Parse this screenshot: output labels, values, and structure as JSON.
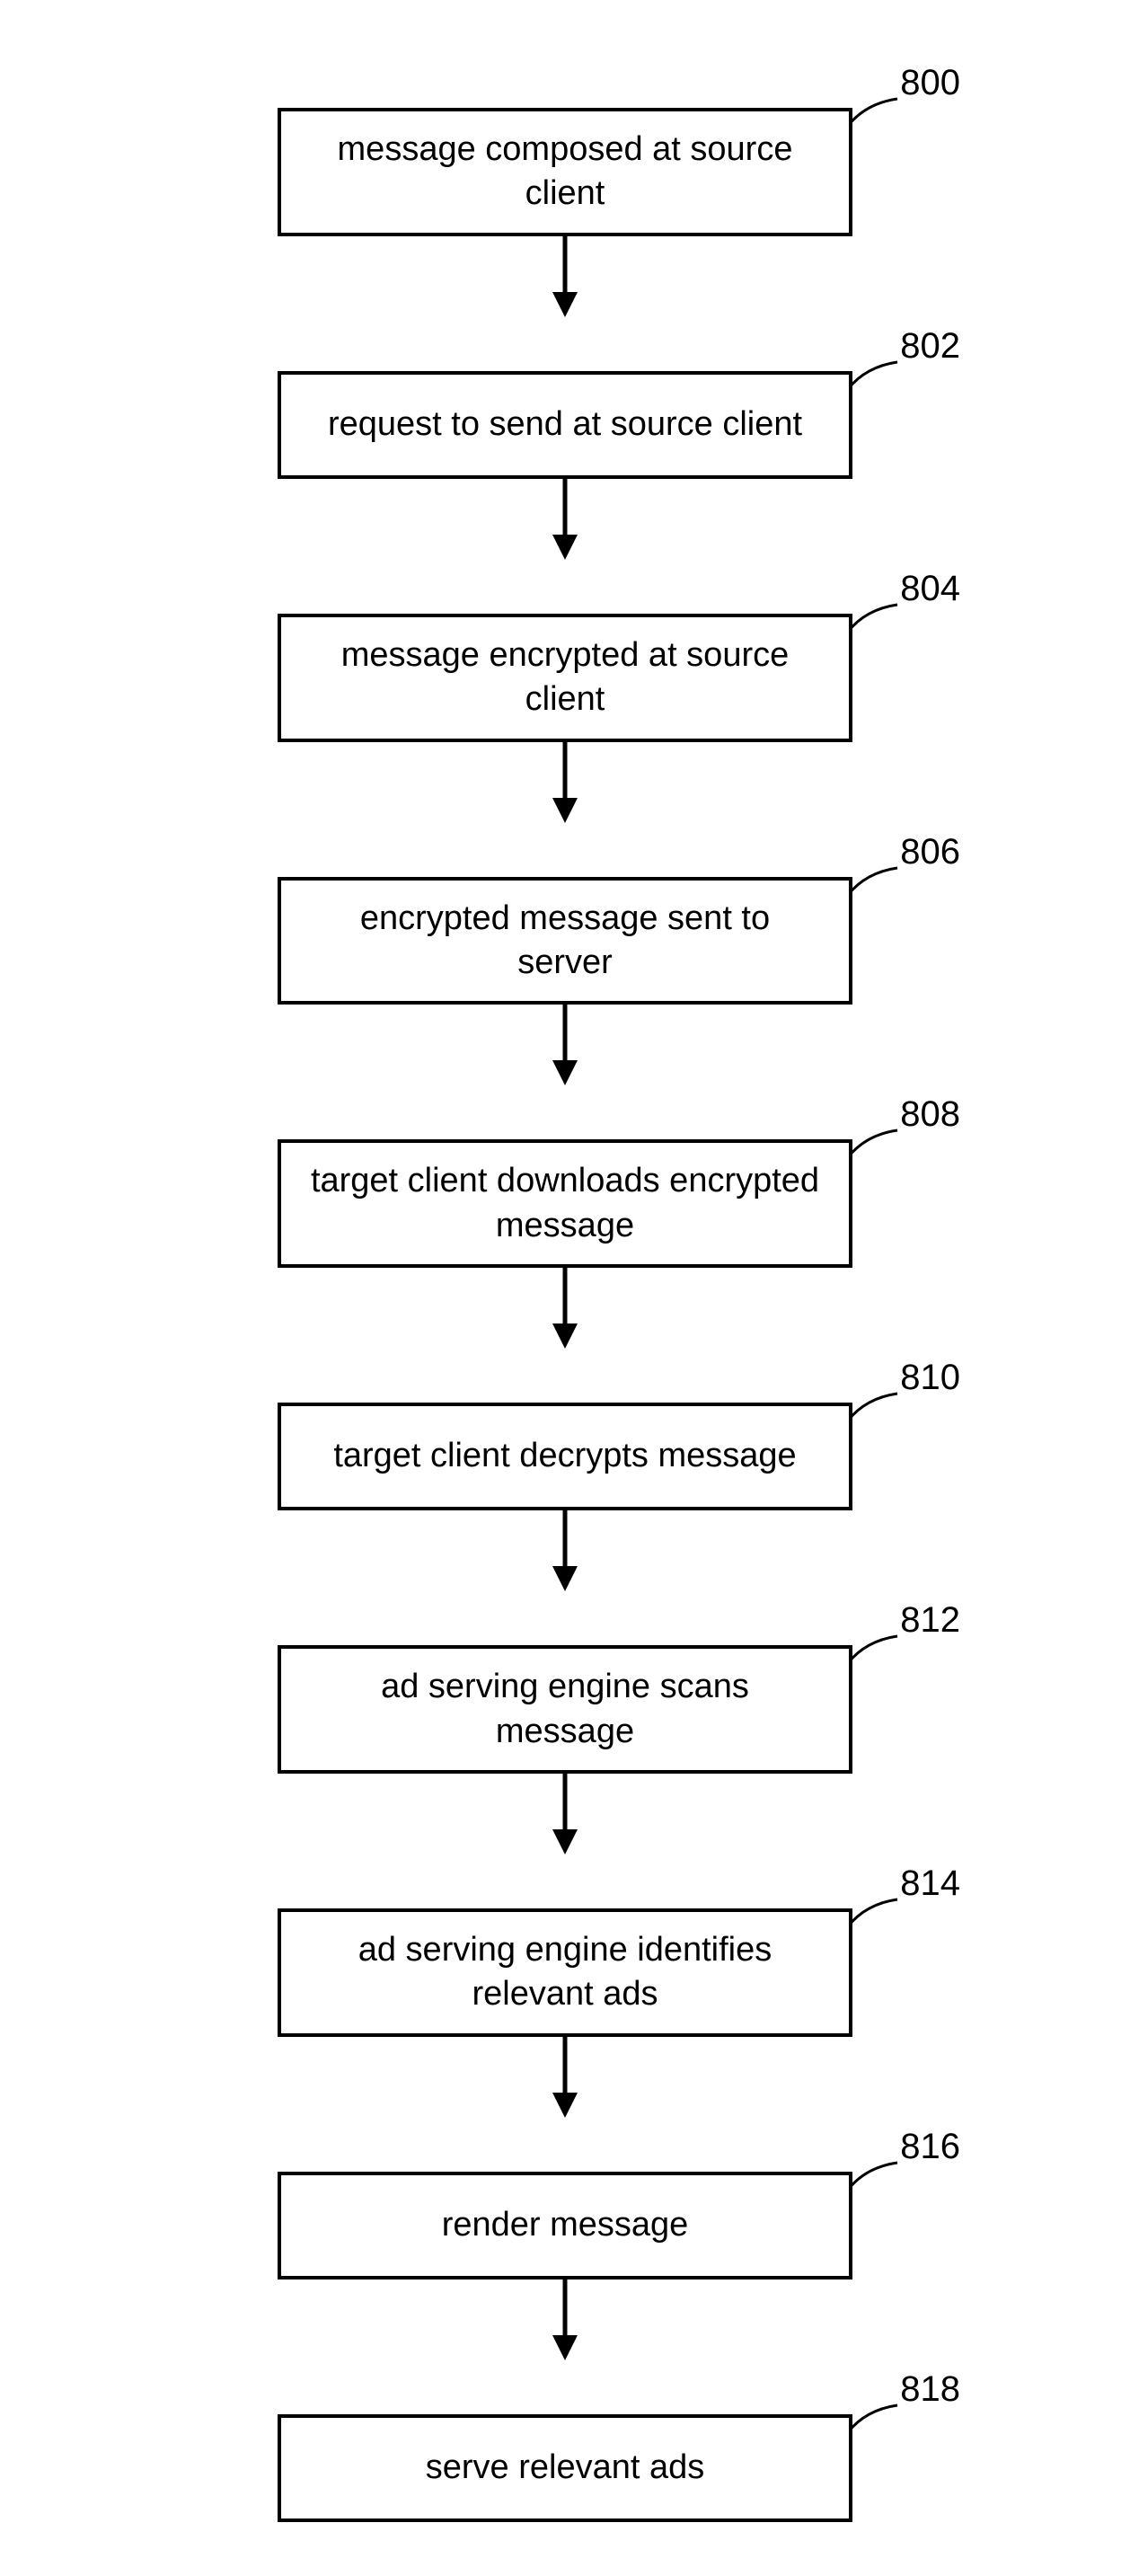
{
  "flowchart": {
    "steps": [
      {
        "ref": "800",
        "text": "message composed at source client"
      },
      {
        "ref": "802",
        "text": "request to send at source client"
      },
      {
        "ref": "804",
        "text": "message encrypted at source client"
      },
      {
        "ref": "806",
        "text": "encrypted message sent to server"
      },
      {
        "ref": "808",
        "text": "target client downloads encrypted message"
      },
      {
        "ref": "810",
        "text": "target client decrypts message"
      },
      {
        "ref": "812",
        "text": "ad serving engine scans message"
      },
      {
        "ref": "814",
        "text": "ad serving engine identifies relevant ads"
      },
      {
        "ref": "816",
        "text": "render message"
      },
      {
        "ref": "818",
        "text": "serve relevant ads"
      }
    ]
  }
}
